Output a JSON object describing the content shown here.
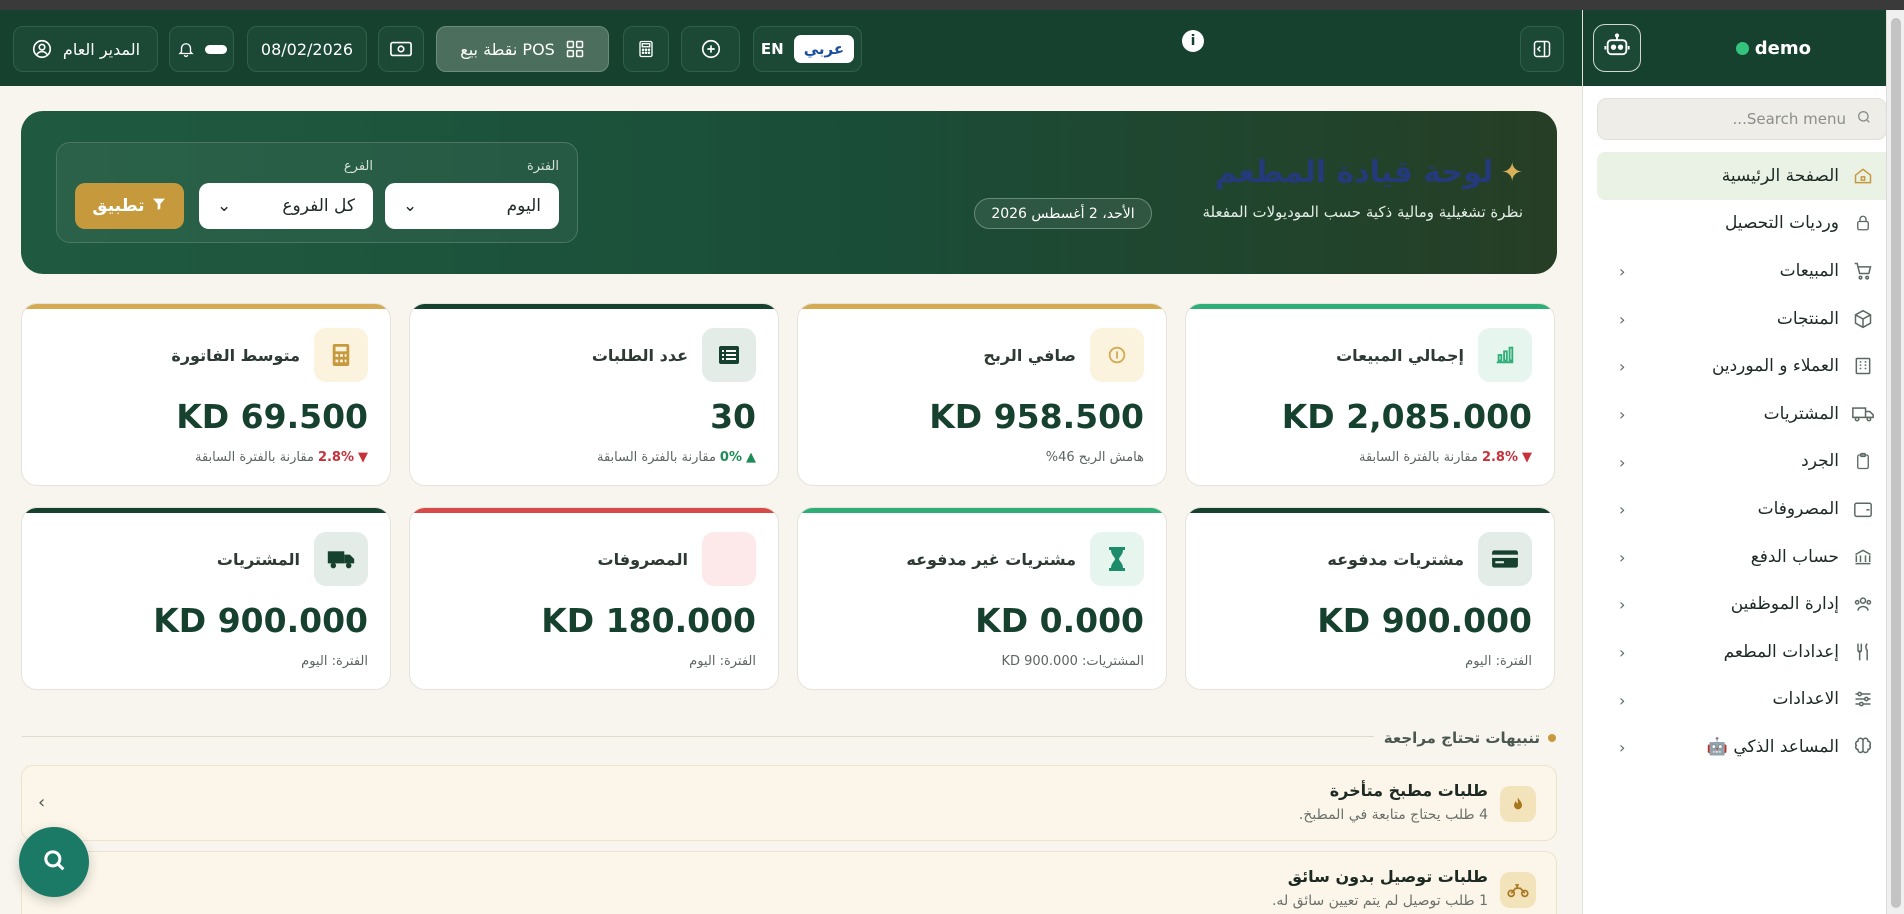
{
  "header": {
    "user_label": "المدير العام",
    "date_value": "08/02/2026",
    "pos_label": "نقطة بيع POS",
    "lang_en": "EN",
    "lang_ar": "عربي"
  },
  "sidebar": {
    "brand": "demo",
    "search_placeholder": "Search menu...",
    "items": [
      {
        "label": "الصفحة الرئيسية",
        "icon": "home-icon"
      },
      {
        "label": "ورديات التحصيل",
        "icon": "lock-icon"
      },
      {
        "label": "المبيعات",
        "icon": "cart-icon"
      },
      {
        "label": "المنتجات",
        "icon": "box-icon"
      },
      {
        "label": "العملاء و الموردين",
        "icon": "building-icon"
      },
      {
        "label": "المشتريات",
        "icon": "truck-icon"
      },
      {
        "label": "الجرد",
        "icon": "clipboard-icon"
      },
      {
        "label": "المصروفات",
        "icon": "wallet-icon"
      },
      {
        "label": "حساب الدفع",
        "icon": "bank-icon"
      },
      {
        "label": "إدارة الموظفين",
        "icon": "users-icon"
      },
      {
        "label": "إعدادات المطعم",
        "icon": "utensils-icon"
      },
      {
        "label": "الاعدادات",
        "icon": "sliders-icon"
      },
      {
        "label": "المساعد الذكي 🤖",
        "icon": "brain-icon"
      }
    ]
  },
  "hero": {
    "title": "لوحة قيادة المطعم",
    "subtitle": "نظرة تشغيلية ومالية ذكية حسب الموديولات المفعلة",
    "date": "الأحد، 2 أغسطس 2026",
    "period_label": "الفترة",
    "period_value": "اليوم",
    "branch_label": "الفرع",
    "branch_value": "كل الفروع",
    "apply_label": "تطبيق"
  },
  "cards": [
    {
      "label": "إجمالي المبيعات",
      "value": "KD 2,085.000",
      "change": "2.8%",
      "change_text": "مقارنة بالفترة السابقة",
      "dir": "down",
      "accent": "#2fae78",
      "icon_bg": "#e6f5ee",
      "icon": "chart-icon"
    },
    {
      "label": "صافي الربح",
      "value": "KD 958.500",
      "change": "",
      "change_text": "هامش الربح 46%",
      "dir": "none",
      "accent": "#d4aa52",
      "icon_bg": "#fbf3de",
      "icon": "coin-icon"
    },
    {
      "label": "عدد الطلبات",
      "value": "30",
      "change": "0%",
      "change_text": "مقارنة بالفترة السابقة",
      "dir": "up",
      "accent": "#17412f",
      "icon_bg": "#e3ece7",
      "icon": "list-icon"
    },
    {
      "label": "متوسط الفاتورة",
      "value": "KD 69.500",
      "change": "2.8%",
      "change_text": "مقارنة بالفترة السابقة",
      "dir": "down",
      "accent": "#d4aa52",
      "icon_bg": "#fbf3de",
      "icon": "calculator-icon"
    },
    {
      "label": "مشتريات مدفوعه",
      "value": "KD 900.000",
      "change": "",
      "change_text": "الفترة: اليوم",
      "dir": "none",
      "accent": "#17412f",
      "icon_bg": "#e3ece7",
      "icon": "credit-card-icon"
    },
    {
      "label": "مشتريات غير مدفوعه",
      "value": "KD 0.000",
      "change": "",
      "change_text": "المشتريات: KD 900.000",
      "dir": "none",
      "accent": "#2fae78",
      "icon_bg": "#e6f5ee",
      "icon": "hourglass-icon"
    },
    {
      "label": "المصروفات",
      "value": "KD 180.000",
      "change": "",
      "change_text": "الفترة: اليوم",
      "dir": "none",
      "accent": "#d84a4a",
      "icon_bg": "#fde9e9",
      "icon": "receipt-icon"
    },
    {
      "label": "المشتريات",
      "value": "KD 900.000",
      "change": "",
      "change_text": "الفترة: اليوم",
      "dir": "none",
      "accent": "#17412f",
      "icon_bg": "#e3ece7",
      "icon": "truck-icon"
    }
  ],
  "alerts": {
    "heading": "تنبيهات تحتاج مراجعة",
    "items": [
      {
        "title": "طلبات مطبخ متأخرة",
        "text": "4 طلب يحتاج متابعة في المطبخ.",
        "icon": "fire-icon"
      },
      {
        "title": "طلبات توصيل بدون سائق",
        "text": "1 طلب توصيل لم يتم تعيين سائق له.",
        "icon": "motorcycle-icon"
      }
    ]
  }
}
